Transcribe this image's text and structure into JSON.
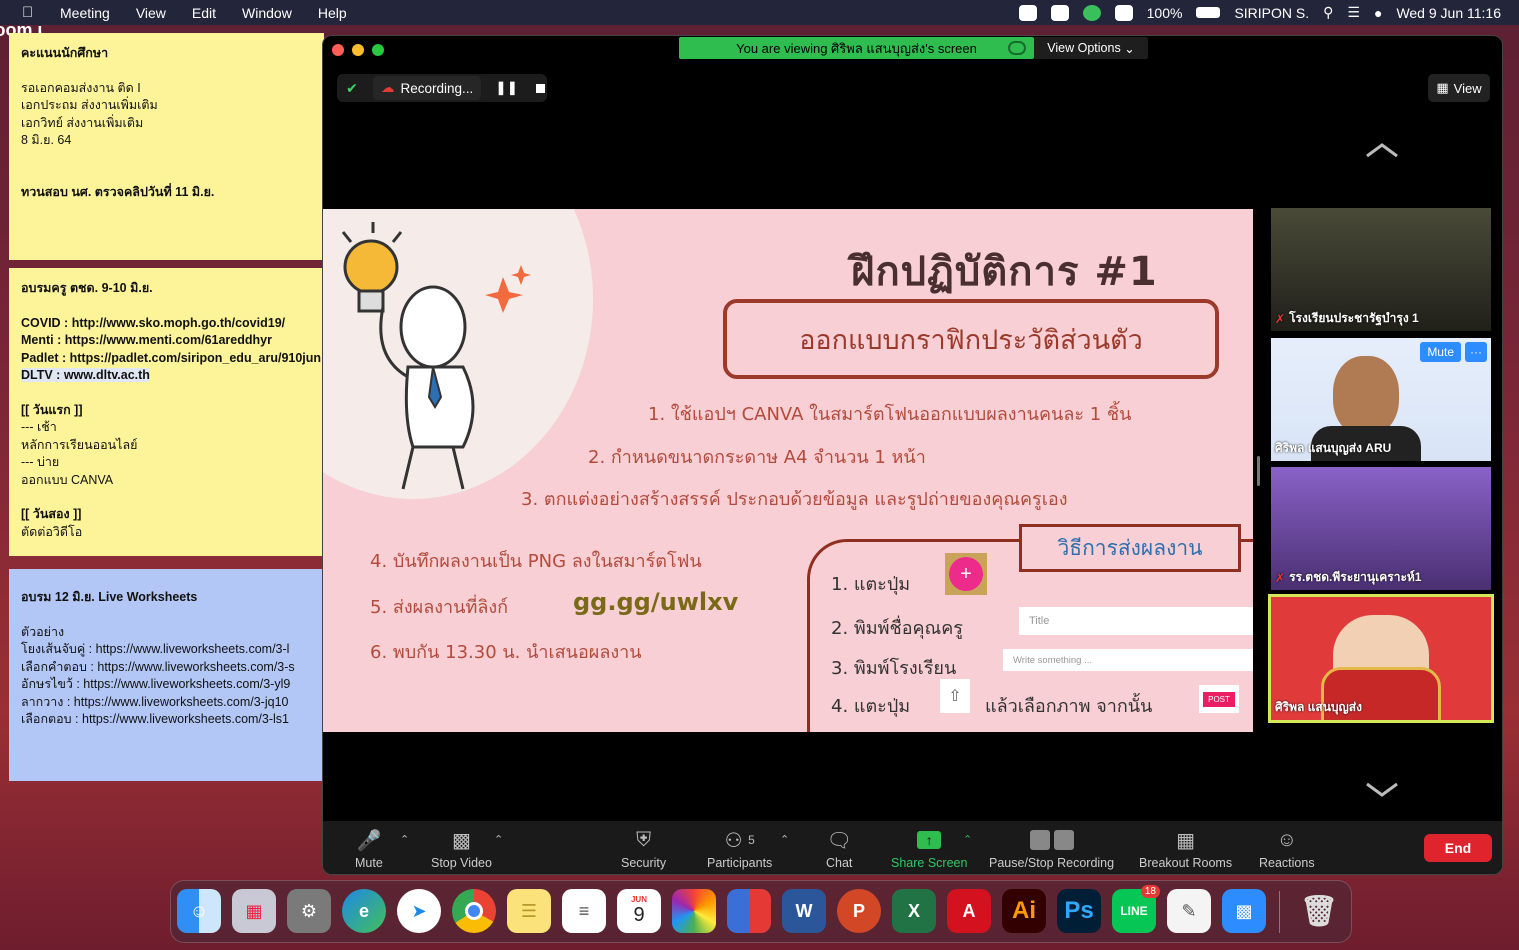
{
  "menubar": {
    "app": "zoom.us",
    "items": [
      "Meeting",
      "View",
      "Edit",
      "Window",
      "Help"
    ],
    "battery": "100%",
    "user": "SIRIPON S.",
    "datetime": "Wed 9 Jun  11:16"
  },
  "notes": [
    {
      "lines": [
        "คะแนนนักศึกษา",
        "",
        "รอเอกคอมส่งงาน ติด I",
        "เอกประถม ส่งงานเพิ่มเติม",
        "เอกวิทย์ ส่งงานเพิ่มเติม",
        "8 มิ.ย. 64",
        "",
        "",
        "ทวนสอบ นศ. ตรวจคลิปวันที่ 11 มิ.ย."
      ]
    },
    {
      "lines": [
        "อบรมครู ตชด. 9-10 มิ.ย.",
        "",
        "COVID : http://www.sko.moph.go.th/covid19/",
        "Menti : https://www.menti.com/61areddhyr",
        "Padlet : https://padlet.com/siripon_edu_aru/910jun",
        "DLTV : www.dltv.ac.th",
        "",
        "[[ วันแรก ]]",
        "--- เช้า",
        "หลักการเรียนออนไลย์",
        "--- บ่าย",
        "ออกแบบ CANVA",
        "",
        "[[ วันสอง ]]",
        "ตัดต่อวิดีโอ"
      ]
    },
    {
      "lines": [
        "อบรม 12 มิ.ย. Live Worksheets",
        "",
        "ตัวอย่าง",
        "โยงเส้นจับคู่ : https://www.liveworksheets.com/3-l",
        "เลือกคำตอบ : https://www.liveworksheets.com/3-s",
        "อักษรไขว้ : https://www.liveworksheets.com/3-yl9",
        "ลากวาง : https://www.liveworksheets.com/3-jq10",
        "เลือกตอบ : https://www.liveworksheets.com/3-ls1"
      ]
    }
  ],
  "zoom": {
    "banner": "You are viewing ศิริพล แสนบุญส่ง's screen",
    "view_options": "View Options",
    "recording": "Recording...",
    "view": "View",
    "slide": {
      "title": "ฝึกปฏิบัติการ #1",
      "subtitle": "ออกแบบกราฟิกประวัติส่วนตัว",
      "item1": "1. ใช้แอปฯ CANVA ในสมาร์ตโฟนออกแบบผลงานคนละ 1 ชิ้น",
      "item2": "2. กำหนดขนาดกระดาษ A4 จำนวน 1 หน้า",
      "item3": "3. ตกแต่งอย่างสร้างสรรค์ ประกอบด้วยข้อมูล และรูปถ่ายของคุณครูเอง",
      "item4": "4. บันทึกผลงานเป็น PNG ลงในสมาร์ตโฟน",
      "item5": "5. ส่งผลงานที่ลิงก์",
      "link": "gg.gg/uwlxv",
      "item6": "6. พบกัน 13.30 น. นำเสนอผลงาน",
      "submit_header": "วิธีการส่งผลงาน",
      "step1": "1. แตะปุ่ม",
      "step2": "2. พิมพ์ชื่อคุณครู",
      "step3": "3. พิมพ์โรงเรียน",
      "step4": "4. แตะปุ่ม",
      "step4b": "แล้วเลือกภาพ จากนั้น",
      "title_placeholder": "Title",
      "write_placeholder": "Write something ...",
      "post": "POST",
      "plus": "+"
    },
    "participants": [
      {
        "name": "โรงเรียนประชารัฐบำรุง 1",
        "muted": true
      },
      {
        "name": "ศิริพล แสนบุญส่ง ARU",
        "muted": false,
        "mute_label": "Mute",
        "more_label": "···"
      },
      {
        "name": "รร.ตชด.พีระยานุเคราะห์1",
        "muted": true
      },
      {
        "name": "ศิริพล แสนบุญส่ง",
        "muted": false
      }
    ],
    "toolbar": {
      "mute": "Mute",
      "stop_video": "Stop Video",
      "security": "Security",
      "participants": "Participants",
      "participants_count": "5",
      "chat": "Chat",
      "share_screen": "Share Screen",
      "pause_stop": "Pause/Stop Recording",
      "breakout": "Breakout Rooms",
      "reactions": "Reactions",
      "end": "End"
    }
  },
  "dock": {
    "calendar_month": "JUN",
    "calendar_day": "9",
    "line_badge": "18",
    "apps": [
      "Finder",
      "Launchpad",
      "System Preferences",
      "Edge",
      "Safari",
      "Chrome",
      "Notes",
      "Reminders",
      "Calendar",
      "Photos",
      "Parallels",
      "Word",
      "PowerPoint",
      "Excel",
      "Acrobat",
      "Illustrator",
      "Photoshop",
      "LINE",
      "TextEdit",
      "Zoom",
      "Trash"
    ]
  },
  "colors": {
    "accent_green": "#2ebd4e",
    "end_red": "#e0242d",
    "note_yellow": "#fdf49a",
    "note_blue": "#b3c7f7",
    "slide_pink": "#f8cfd5"
  }
}
